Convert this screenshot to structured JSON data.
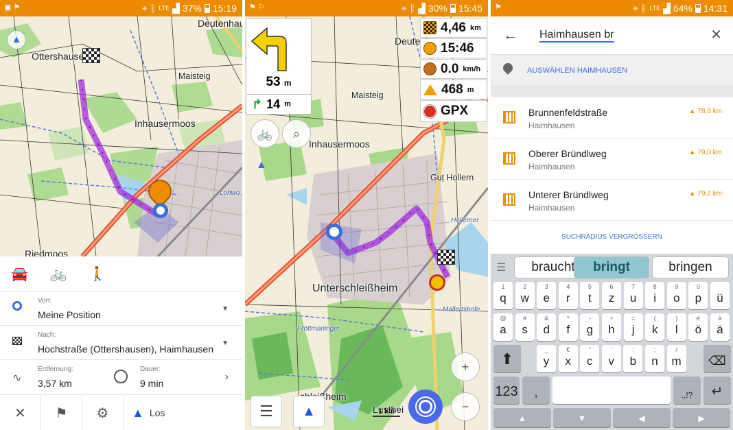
{
  "panel1": {
    "status": {
      "battery": "37%",
      "time": "15:19"
    },
    "map_labels": [
      "Deutenhausen",
      "Ottershausen",
      "Maisteig",
      "Inhausermoos",
      "Riedmoos",
      "Lohwo"
    ],
    "modes": [
      "car-icon",
      "bicycle-icon",
      "walk-icon"
    ],
    "from": {
      "label": "Von:",
      "value": "Meine Position"
    },
    "to": {
      "label": "Nach:",
      "value": "Hochstraße (Ottershausen), Haimhausen"
    },
    "distance": {
      "label": "Entfernung:",
      "value": "3,57 km"
    },
    "duration": {
      "label": "Dauer:",
      "value": "9 min"
    },
    "toolbar": {
      "go_label": "Los"
    }
  },
  "panel2": {
    "status": {
      "battery": "30%",
      "time": "15:45"
    },
    "turn": {
      "distance": "53",
      "unit": "m"
    },
    "next_turn": {
      "distance": "14",
      "unit": "m"
    },
    "widgets": [
      {
        "value": "4,46",
        "unit": "km"
      },
      {
        "value": "15:46",
        "unit": ""
      },
      {
        "value": "0.0",
        "unit": "km/h"
      },
      {
        "value": "468",
        "unit": "m"
      },
      {
        "value": "GPX",
        "unit": ""
      }
    ],
    "map_labels": [
      "Deutenha",
      "Maisteig",
      "Inhausermoos",
      "Gut Hollern",
      "Hollerner",
      "Unterschleißheim",
      "Mallertshofe",
      "Fröttmaninger",
      "Lusthei",
      "chleißheim"
    ],
    "scale": "1 km"
  },
  "panel3": {
    "status": {
      "battery": "64%",
      "time": "14:31"
    },
    "search": {
      "value": "Haimhausen br"
    },
    "suggestion": "AUSWÄHLEN HAIMHAUSEN",
    "results": [
      {
        "name": "Brunnenfeldstraße",
        "sub": "Haimhausen",
        "dist": "78,6 km"
      },
      {
        "name": "Oberer Bründlweg",
        "sub": "Haimhausen",
        "dist": "79,0 km"
      },
      {
        "name": "Unterer Bründlweg",
        "sub": "Haimhausen",
        "dist": "79,2 km"
      }
    ],
    "radius_label": "SUCHRADIUS VERGRÖSSERN",
    "candidates": [
      "braucht",
      "bringt",
      "bringen"
    ],
    "row1": [
      [
        "1",
        "q"
      ],
      [
        "2",
        "w"
      ],
      [
        "3",
        "e"
      ],
      [
        "4",
        "r"
      ],
      [
        "5",
        "t"
      ],
      [
        "6",
        "z"
      ],
      [
        "7",
        "u"
      ],
      [
        "8",
        "i"
      ],
      [
        "9",
        "o"
      ],
      [
        "0",
        "p"
      ],
      [
        "",
        "ü"
      ]
    ],
    "row2": [
      [
        "@",
        "a"
      ],
      [
        "#",
        "s"
      ],
      [
        "&",
        "d"
      ],
      [
        "*",
        "f"
      ],
      [
        "-",
        "g"
      ],
      [
        "+",
        "h"
      ],
      [
        "=",
        "j"
      ],
      [
        "(",
        "k"
      ],
      [
        ")",
        "l"
      ],
      [
        "é",
        "ö"
      ],
      [
        "à",
        "ä"
      ]
    ],
    "row3": [
      [
        "_",
        "y"
      ],
      [
        "€",
        "x"
      ],
      [
        "\"",
        "c"
      ],
      [
        "'",
        "v"
      ],
      [
        ":",
        "b"
      ],
      [
        ";",
        "n"
      ],
      [
        "/",
        "m"
      ]
    ],
    "num_key": "123",
    "comma_key": ",",
    "punct_key": ".,!?"
  }
}
